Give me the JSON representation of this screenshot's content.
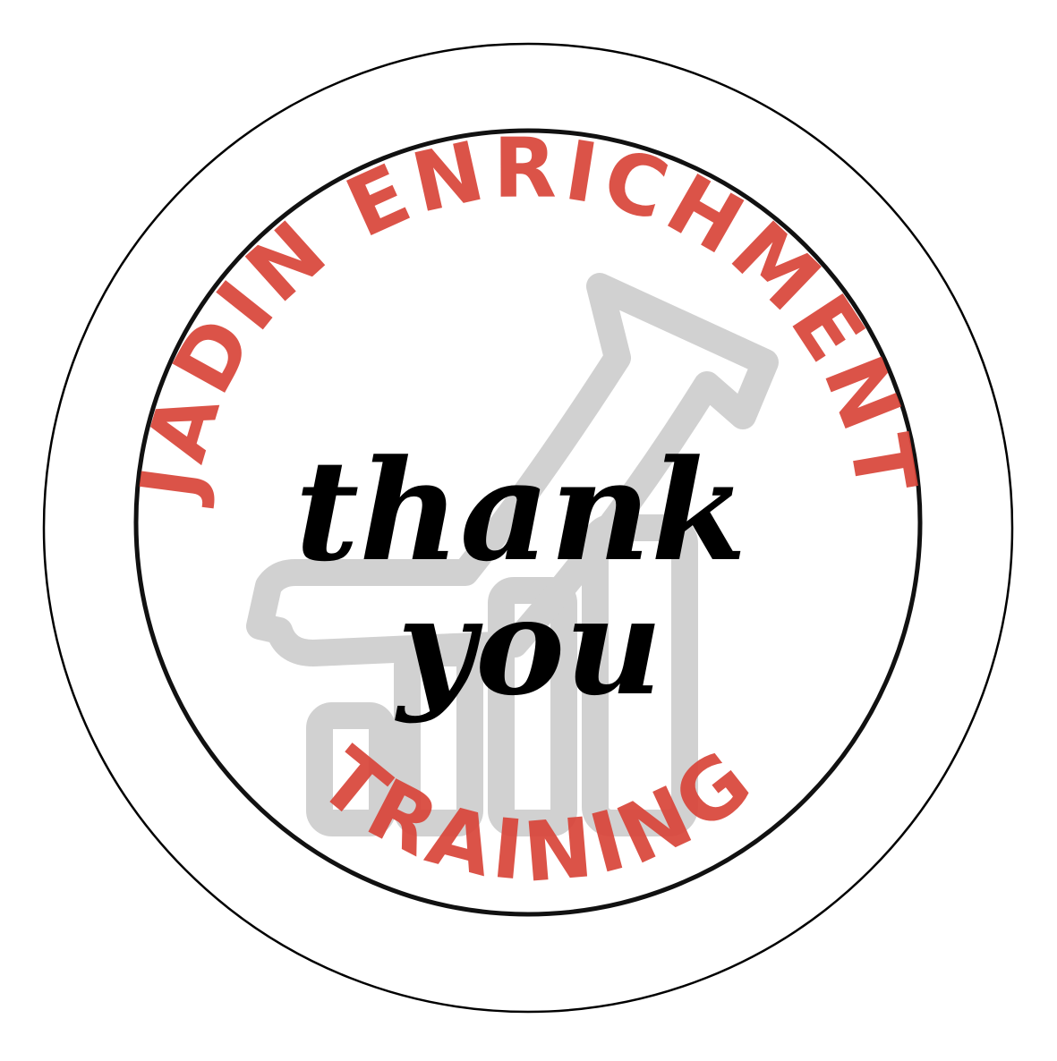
{
  "badge": {
    "top_arc_text": "JADIN ENRICHMENT",
    "bottom_arc_text": "TRAINING",
    "center_line_1": "thank",
    "center_line_2": "you"
  },
  "icons": {
    "watermark": "growth-arrow-bar-chart-icon"
  },
  "colors": {
    "background": "#ffffff",
    "outer_ring": "#000000",
    "inner_ring": "#111111",
    "brand_red": "#d9463b",
    "script_text": "#000000",
    "watermark": "#c9c9c9"
  }
}
